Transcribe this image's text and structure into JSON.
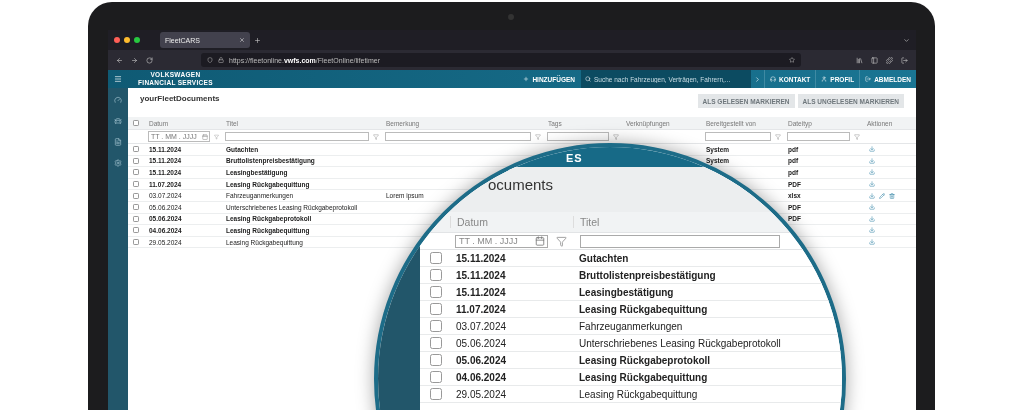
{
  "browser": {
    "tab_title": "FleetCARS",
    "url": "https://fleetonline.**vwfs.com**/FleetOnline/lifetimer"
  },
  "app_header": {
    "logo_lines": [
      "VOLKSWAGEN",
      "FINANCIAL SERVICES"
    ],
    "add_button": "HINZUFÜGEN",
    "search": {
      "placeholder": "Suche nach Fahrzeugen, Verträgen, Fahrern,..."
    },
    "nav": [
      {
        "kind": "contact",
        "label": "KONTAKT"
      },
      {
        "kind": "profile",
        "label": "PROFIL"
      },
      {
        "kind": "logout",
        "label": "ABMELDEN"
      }
    ]
  },
  "page": {
    "title": "yourFleetDocuments",
    "actions": [
      {
        "label": "ALS GELESEN MARKIEREN",
        "disabled": true
      },
      {
        "label": "ALS UNGELESEN MARKIEREN",
        "disabled": true
      }
    ]
  },
  "table": {
    "select_all_checked": false,
    "columns": [
      {
        "label": "Datum",
        "kind": "date",
        "placeholder": "TT . MM . JJJJ"
      },
      {
        "label": "Titel",
        "kind": "text"
      },
      {
        "label": "Bemerkung",
        "kind": "text"
      },
      {
        "label": "Tags",
        "kind": "text"
      },
      {
        "label": "Verknüpfungen",
        "kind": "plain"
      },
      {
        "label": "Bereitgestellt von",
        "kind": "text"
      },
      {
        "label": "Dateityp",
        "kind": "text"
      },
      {
        "label": "Aktionen",
        "kind": "plain"
      }
    ],
    "rows": [
      {
        "checked": false,
        "unread": true,
        "date": "15.11.2024",
        "title": "Gutachten",
        "provided_by": "System",
        "file_type": "pdf",
        "editable": false
      },
      {
        "checked": false,
        "unread": true,
        "date": "15.11.2024",
        "title": "Bruttolistenpreisbestätigung",
        "provided_by": "System",
        "file_type": "pdf",
        "editable": false
      },
      {
        "checked": false,
        "unread": true,
        "date": "15.11.2024",
        "title": "Leasingbestätigung",
        "file_type": "pdf",
        "editable": false
      },
      {
        "checked": false,
        "unread": true,
        "date": "11.07.2024",
        "title": "Leasing Rückgabequittung",
        "file_type": "PDF",
        "editable": false
      },
      {
        "checked": false,
        "unread": false,
        "date": "03.07.2024",
        "title": "Fahrzeuganmerkungen",
        "remark": "Lorem ipsum",
        "file_type": "xlsx",
        "editable": true
      },
      {
        "checked": false,
        "unread": false,
        "date": "05.06.2024",
        "title": "Unterschriebenes Leasing Rückgabeprotokoll",
        "file_type": "PDF",
        "editable": false
      },
      {
        "checked": false,
        "unread": true,
        "date": "05.06.2024",
        "title": "Leasing Rückgabeprotokoll",
        "file_type": "PDF",
        "editable": false
      },
      {
        "checked": false,
        "unread": true,
        "date": "04.06.2024",
        "title": "Leasing Rückgabequittung",
        "editable": false
      },
      {
        "checked": false,
        "unread": false,
        "date": "29.05.2024",
        "title": "Leasing Rückgabequittung",
        "editable": false
      }
    ]
  },
  "magnifier": {
    "header": "ES",
    "title": "ocuments",
    "columns": [
      "Datum",
      "Titel"
    ],
    "date_placeholder": "TT . MM . JJJJ",
    "rows": [
      {
        "checked": false,
        "unread": true,
        "date": "15.11.2024",
        "title": "Gutachten"
      },
      {
        "checked": false,
        "unread": true,
        "date": "15.11.2024",
        "title": "Bruttolistenpreisbestätigung"
      },
      {
        "checked": false,
        "unread": true,
        "date": "15.11.2024",
        "title": "Leasingbestätigung"
      },
      {
        "checked": false,
        "unread": true,
        "date": "11.07.2024",
        "title": "Leasing Rückgabequittung"
      },
      {
        "checked": false,
        "unread": false,
        "date": "03.07.2024",
        "title": "Fahrzeuganmerkungen"
      },
      {
        "checked": false,
        "unread": false,
        "date": "05.06.2024",
        "title": "Unterschriebenes Leasing Rückgabeprotokoll"
      },
      {
        "checked": false,
        "unread": true,
        "date": "05.06.2024",
        "title": "Leasing Rückgabeprotokoll"
      },
      {
        "checked": false,
        "unread": true,
        "date": "04.06.2024",
        "title": "Leasing Rückgabequittung"
      },
      {
        "checked": false,
        "unread": false,
        "date": "29.05.2024",
        "title": "Leasing Rückgabequittung"
      }
    ]
  }
}
